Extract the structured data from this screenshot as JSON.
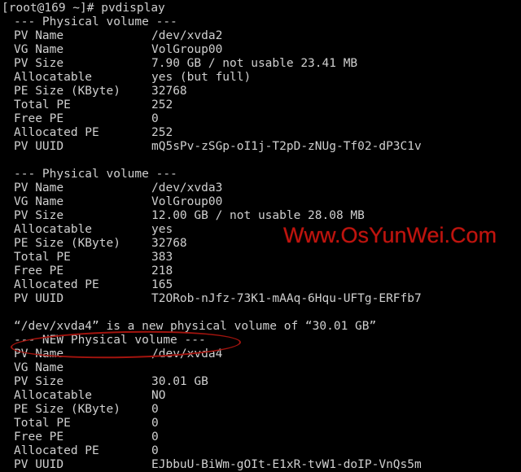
{
  "terminal": {
    "prompt_line": "[root@169 ~]# pvdisplay",
    "colors": {
      "background": "#000000",
      "foreground": "#cfcfcf",
      "annotation": "#a3140e",
      "watermark": "#c0140e"
    },
    "blocks": [
      {
        "header": "--- Physical volume ---",
        "rows": [
          {
            "label": "PV Name",
            "value": "/dev/xvda2"
          },
          {
            "label": "VG Name",
            "value": "VolGroup00"
          },
          {
            "label": "PV Size",
            "value": "7.90 GB / not usable 23.41 MB"
          },
          {
            "label": "Allocatable",
            "value": "yes (but full)"
          },
          {
            "label": "PE Size (KByte)",
            "value": "32768"
          },
          {
            "label": "Total PE",
            "value": "252"
          },
          {
            "label": "Free PE",
            "value": "0"
          },
          {
            "label": "Allocated PE",
            "value": "252"
          },
          {
            "label": "PV UUID",
            "value": "mQ5sPv-zSGp-oI1j-T2pD-zNUg-Tf02-dP3C1v"
          }
        ]
      },
      {
        "header": "--- Physical volume ---",
        "rows": [
          {
            "label": "PV Name",
            "value": "/dev/xvda3"
          },
          {
            "label": "VG Name",
            "value": "VolGroup00"
          },
          {
            "label": "PV Size",
            "value": "12.00 GB / not usable 28.08 MB"
          },
          {
            "label": "Allocatable",
            "value": "yes"
          },
          {
            "label": "PE Size (KByte)",
            "value": "32768"
          },
          {
            "label": "Total PE",
            "value": "383"
          },
          {
            "label": "Free PE",
            "value": "218"
          },
          {
            "label": "Allocated PE",
            "value": "165"
          },
          {
            "label": "PV UUID",
            "value": "T2ORob-nJfz-73K1-mAAq-6Hqu-UFTg-ERFfb7"
          }
        ]
      },
      {
        "notice": "“/dev/xvda4” is a new physical volume of “30.01 GB”",
        "header": "--- NEW Physical volume ---",
        "rows": [
          {
            "label": "PV Name",
            "value": "/dev/xvda4"
          },
          {
            "label": "VG Name",
            "value": ""
          },
          {
            "label": "PV Size",
            "value": "30.01 GB"
          },
          {
            "label": "Allocatable",
            "value": "NO"
          },
          {
            "label": "PE Size (KByte)",
            "value": "0"
          },
          {
            "label": "Total PE",
            "value": "0"
          },
          {
            "label": "Free PE",
            "value": "0"
          },
          {
            "label": "Allocated PE",
            "value": "0"
          },
          {
            "label": "PV UUID",
            "value": "EJbbuU-BiWm-gOIt-E1xR-tvW1-doIP-VnQs5m"
          }
        ]
      }
    ]
  },
  "watermark": {
    "text": "Www.OsYunWei.Com"
  },
  "annotation": {
    "shape": "ellipse",
    "targets": "VG Name"
  }
}
